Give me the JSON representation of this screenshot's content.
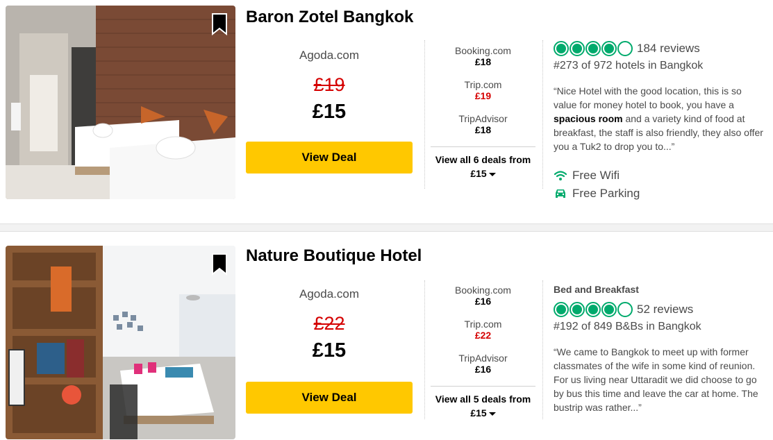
{
  "hotels": [
    {
      "name": "Baron Zotel Bangkok",
      "main_provider": "Agoda.com",
      "old_price": "£19",
      "price": "£15",
      "deal_button": "View Deal",
      "other_offers": [
        {
          "provider": "Booking.com",
          "price": "£18",
          "highlight": false
        },
        {
          "provider": "Trip.com",
          "price": "£19",
          "highlight": true
        },
        {
          "provider": "TripAdvisor",
          "price": "£18",
          "highlight": false
        }
      ],
      "view_all_label": "View all 6 deals from",
      "view_all_price": "£15",
      "category": "",
      "rating": 4,
      "reviews": "184 reviews",
      "rank": "#273 of 972 hotels in Bangkok",
      "quote_before": "“Nice Hotel with the good location, this is so value for money hotel to book, you have a ",
      "quote_bold": "spacious room",
      "quote_after": " and a variety kind of food at breakfast, the staff is also friendly, they also offer you a Tuk2 to drop you to...”",
      "amenities": [
        {
          "icon": "wifi-icon",
          "label": "Free Wifi"
        },
        {
          "icon": "car-icon",
          "label": "Free Parking"
        }
      ]
    },
    {
      "name": "Nature Boutique Hotel",
      "main_provider": "Agoda.com",
      "old_price": "£22",
      "price": "£15",
      "deal_button": "View Deal",
      "other_offers": [
        {
          "provider": "Booking.com",
          "price": "£16",
          "highlight": false
        },
        {
          "provider": "Trip.com",
          "price": "£22",
          "highlight": true
        },
        {
          "provider": "TripAdvisor",
          "price": "£16",
          "highlight": false
        }
      ],
      "view_all_label": "View all 5 deals from",
      "view_all_price": "£15",
      "category": "Bed and Breakfast",
      "rating": 4,
      "reviews": "52 reviews",
      "rank": "#192 of 849 B&Bs in Bangkok",
      "quote_before": "“We came to Bangkok to meet up with former classmates of the wife in some kind of reunion. For us living near Uttaradit we did choose to go by bus this time and leave the car at home. The bustrip was rather...”",
      "quote_bold": "",
      "quote_after": "",
      "amenities": []
    }
  ],
  "colors": {
    "deal_button": "#ffc800",
    "strike_price": "#d50000",
    "rating_green": "#00aa6c",
    "text_gray": "#4a4a4a"
  }
}
